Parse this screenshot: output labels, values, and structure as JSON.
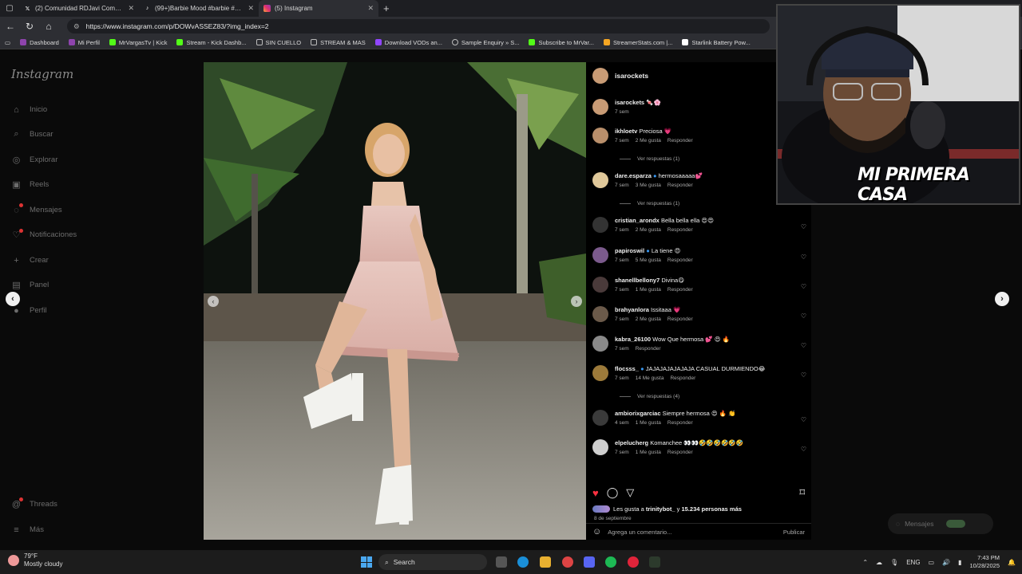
{
  "browser": {
    "tabs": [
      {
        "title": "(2) Comunidad RDJavi Communit",
        "icon": "x-logo-icon",
        "color": "#ffffff"
      },
      {
        "title": "(99+)Barbie Mood #barbie #barb",
        "icon": "tiktok-icon",
        "color": "#ffffff"
      },
      {
        "title": "(5) Instagram",
        "icon": "instagram-icon",
        "color": "#e1306c"
      }
    ],
    "url": "https://www.instagram.com/p/DOWvASSEZ83/?img_index=2",
    "bookmarks": [
      {
        "label": "Dashboard",
        "color": "#8e44ad"
      },
      {
        "label": "Mi Perfil",
        "color": "#8e44ad"
      },
      {
        "label": "MrVargasTv | Kick",
        "color": "#53fc18"
      },
      {
        "label": "Stream - Kick Dashb...",
        "color": "#53fc18"
      },
      {
        "label": "SIN CUELLO",
        "color": "#888888"
      },
      {
        "label": "STREAM & MAS",
        "color": "#888888"
      },
      {
        "label": "Download VODs an...",
        "color": "#9146ff"
      },
      {
        "label": "Sample Enquiry » S...",
        "color": "#bbbbbb"
      },
      {
        "label": "Subscribe to MrVar...",
        "color": "#53fc18"
      },
      {
        "label": "StreamerStats.com |...",
        "color": "#f5a623"
      },
      {
        "label": "Starlink Battery Pow...",
        "color": "#ffffff"
      }
    ]
  },
  "sidebar": {
    "logo": "Instagram",
    "items": [
      {
        "label": "Inicio",
        "icon": "home-icon",
        "glyph": "⌂"
      },
      {
        "label": "Buscar",
        "icon": "search-icon",
        "glyph": "⌕"
      },
      {
        "label": "Explorar",
        "icon": "compass-icon",
        "glyph": "◎"
      },
      {
        "label": "Reels",
        "icon": "reels-icon",
        "glyph": "▣"
      },
      {
        "label": "Mensajes",
        "icon": "messenger-icon",
        "glyph": "◌"
      },
      {
        "label": "Notificaciones",
        "icon": "heart-icon",
        "glyph": "♡"
      },
      {
        "label": "Crear",
        "icon": "plus-icon",
        "glyph": "+"
      },
      {
        "label": "Panel",
        "icon": "dashboard-icon",
        "glyph": "▤"
      },
      {
        "label": "Perfil",
        "icon": "profile-icon",
        "glyph": "●"
      }
    ],
    "threads": "Threads",
    "more": "Más"
  },
  "post": {
    "author": "isarockets",
    "caption_user": "isarockets",
    "caption_emoji": "🍬🌸",
    "caption_time": "7 sem",
    "comments": [
      {
        "user": "ikhloetv",
        "text": "Preciosa 💗",
        "time": "7 sem",
        "likes": "2 Me gusta",
        "reply": "Responder",
        "replies": "Ver respuestas (1)",
        "color": "#b98f6b"
      },
      {
        "user": "dare.esparza",
        "verified": true,
        "text": "hermosaaaaa💕",
        "time": "7 sem",
        "likes": "3 Me gusta",
        "reply": "Responder",
        "replies": "Ver respuestas (1)",
        "color": "#e0c89a"
      },
      {
        "user": "cristian_arondx",
        "text": "Bella bella ella 😍😍",
        "time": "7 sem",
        "likes": "2 Me gusta",
        "reply": "Responder",
        "color": "#333333"
      },
      {
        "user": "papiroswil",
        "verified": true,
        "text": "La tiene 😍",
        "time": "7 sem",
        "likes": "5 Me gusta",
        "reply": "Responder",
        "color": "#7b5a8c"
      },
      {
        "user": "shanellbellony7",
        "text": "Divina😋",
        "time": "7 sem",
        "likes": "1 Me gusta",
        "reply": "Responder",
        "color": "#4a3a3a"
      },
      {
        "user": "brahyanlora",
        "text": "Issitaaa 💗",
        "time": "7 sem",
        "likes": "2 Me gusta",
        "reply": "Responder",
        "color": "#6b5a4a"
      },
      {
        "user": "kabra_26100",
        "text": "Wow Que hermosa 💕 😍 🔥",
        "time": "7 sem",
        "reply": "Responder",
        "color": "#8a8a8a"
      },
      {
        "user": "flocsss_",
        "verified": true,
        "text": "JAJAJAJAJAJAJA CASUAL DURMIENDO😂",
        "time": "7 sem",
        "likes": "14 Me gusta",
        "reply": "Responder",
        "replies": "Ver respuestas (4)",
        "color": "#9c7a3a"
      },
      {
        "user": "ambiorixgarciac",
        "text": "Siempre hermosa 😍 🔥 👏",
        "time": "4 sem",
        "likes": "1 Me gusta",
        "reply": "Responder",
        "color": "#3a3a3a"
      },
      {
        "user": "elpelucherg",
        "text": "Komanchee 👀👀🤣🤣🤣🤣🤣🤣",
        "time": "7 sem",
        "likes": "1 Me gusta",
        "reply": "Responder",
        "color": "#cfcfcf"
      }
    ],
    "likes_prefix": "Les gusta a ",
    "likes_user": "trinitybot_",
    "likes_suffix": " y ",
    "likes_count": "15.234 personas más",
    "date": "8 de septiembre",
    "comment_placeholder": "Agrega un comentario...",
    "publish": "Publicar",
    "messages_pill": "Mensajes"
  },
  "webcam": {
    "overlay_text": "MI PRIMERA CASA"
  },
  "taskbar": {
    "temperature": "79°F",
    "weather": "Mostly cloudy",
    "search": "Search",
    "language": "ENG",
    "time": "7:43 PM",
    "date": "10/28/2025"
  }
}
